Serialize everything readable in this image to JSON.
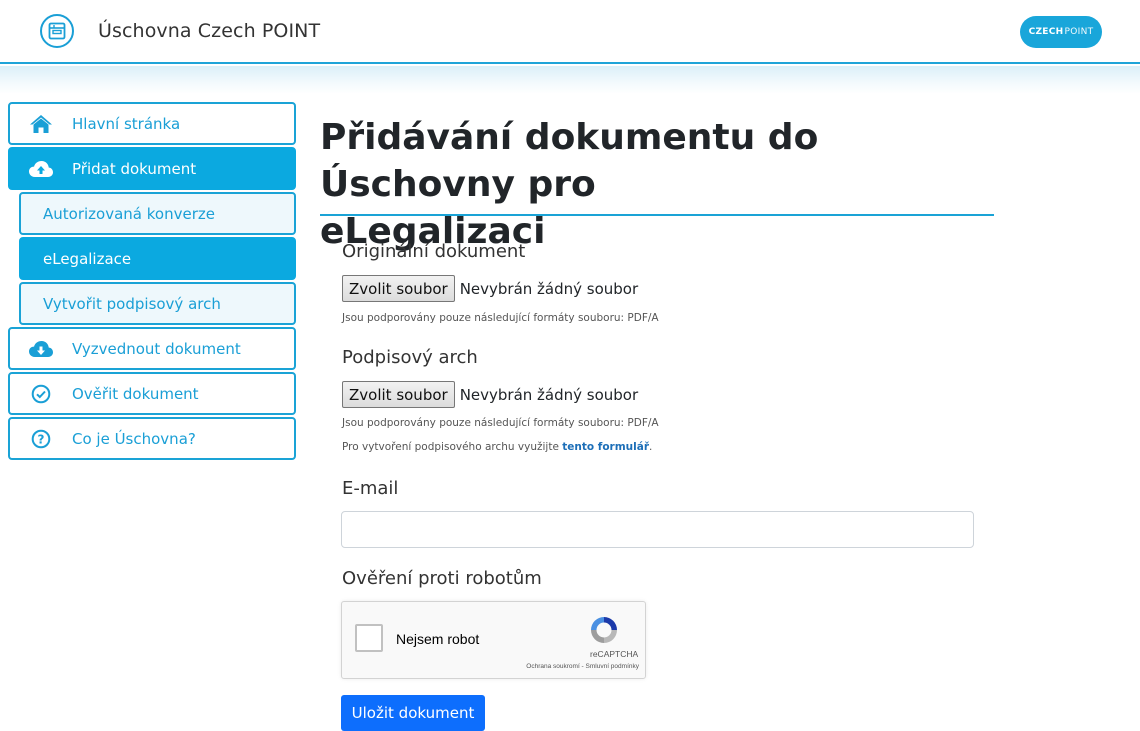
{
  "header": {
    "title": "Úschovna Czech POINT",
    "logo_bold": "CZECH",
    "logo_light": "POINT"
  },
  "sidebar": {
    "items": [
      {
        "label": "Hlavní stránka",
        "icon": "home-icon"
      },
      {
        "label": "Přidat dokument",
        "icon": "cloud-upload-icon"
      },
      {
        "label": "Autorizovaná konverze"
      },
      {
        "label": "eLegalizace"
      },
      {
        "label": "Vytvořit podpisový arch"
      },
      {
        "label": "Vyzvednout dokument",
        "icon": "cloud-download-icon"
      },
      {
        "label": "Ověřit dokument",
        "icon": "check-circle-icon"
      },
      {
        "label": "Co je Úschovna?",
        "icon": "question-circle-icon"
      }
    ]
  },
  "main": {
    "title_line1": "Přidávání dokumentu do Úschovny pro",
    "title_line2": "eLegalizaci",
    "original": {
      "label": "Originální dokument",
      "button": "Zvolit soubor",
      "status": "Nevybrán žádný soubor",
      "hint": "Jsou podporovány pouze následující formáty souboru: PDF/A"
    },
    "signature": {
      "label": "Podpisový arch",
      "button": "Zvolit soubor",
      "status": "Nevybrán žádný soubor",
      "hint": "Jsou podporovány pouze následující formáty souboru: PDF/A",
      "form_hint_prefix": "Pro vytvoření podpisového archu využijte ",
      "form_link": "tento formulář",
      "form_hint_suffix": "."
    },
    "email": {
      "label": "E-mail",
      "value": ""
    },
    "captcha": {
      "label": "Ověření proti robotům",
      "checkbox_label": "Nejsem robot",
      "brand": "reCAPTCHA",
      "terms": "Ochrana soukromí - Smluvní podmínky"
    },
    "save_button": "Uložit dokument"
  },
  "colors": {
    "accent": "#1aa3d6",
    "active": "#0ba9e0",
    "primary_button": "#0d6efd"
  }
}
